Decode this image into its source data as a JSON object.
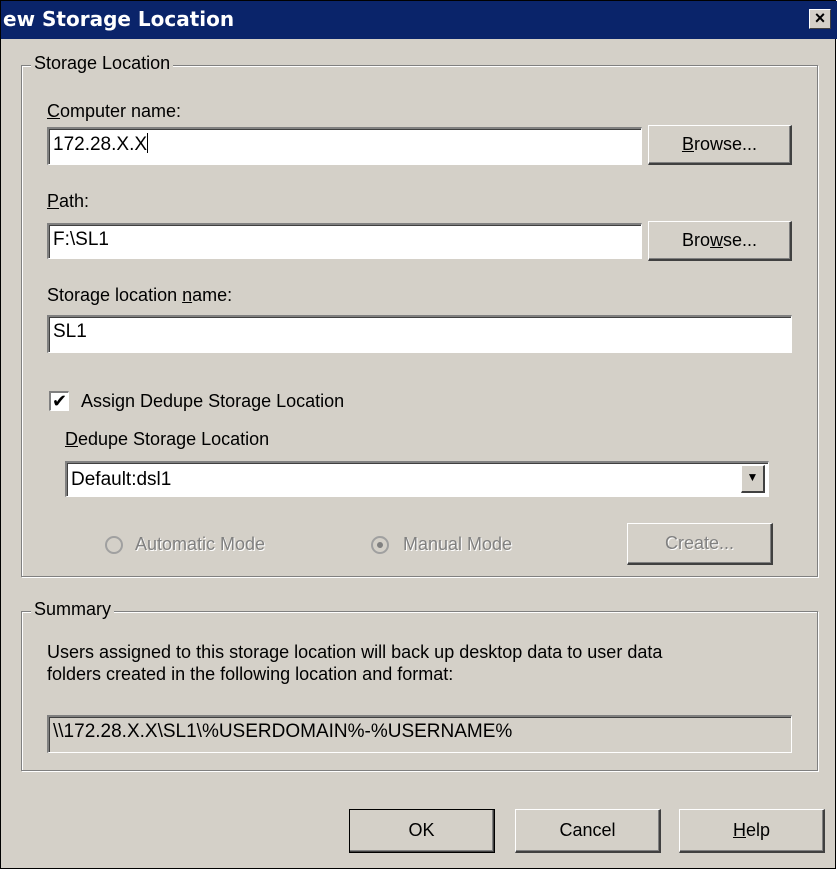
{
  "window": {
    "title": "ew Storage Location",
    "close_glyph": "✕"
  },
  "storage_location": {
    "group_label": "Storage Location",
    "computer_name_label": "Computer name:",
    "computer_name_value": "172.28.X.X",
    "path_label": "Path:",
    "path_value": "F:\\SL1",
    "browse_label": "Browse...",
    "storage_name_label": "Storage location name:",
    "storage_name_value": "SL1",
    "assign_dedupe_label": "Assign Dedupe Storage Location",
    "assign_dedupe_checked": true,
    "dedupe_location_label": "Dedupe Storage Location",
    "dedupe_location_value": "Default:dsl1",
    "automatic_mode_label": "Automatic Mode",
    "manual_mode_label": "Manual Mode",
    "selected_mode": "Manual Mode",
    "create_label": "Create..."
  },
  "summary": {
    "group_label": "Summary",
    "description_line1": "Users assigned to this storage location will back up desktop data to user data",
    "description_line2": "folders created in the following location and format:",
    "path_format": "\\\\172.28.X.X\\SL1\\%USERDOMAIN%-%USERNAME%"
  },
  "buttons": {
    "ok": "OK",
    "cancel": "Cancel",
    "help": "Help"
  },
  "colors": {
    "titlebar": "#0a246a",
    "dialog_face": "#d4d0c8",
    "disabled_text": "#808080"
  }
}
